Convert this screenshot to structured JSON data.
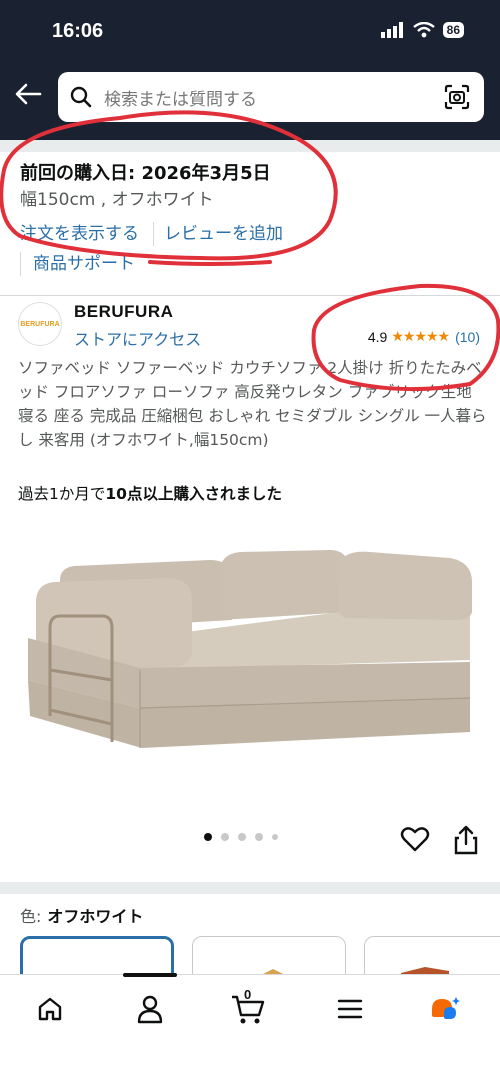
{
  "status_bar": {
    "time": "16:06",
    "battery": "86"
  },
  "search": {
    "placeholder": "検索または質問する"
  },
  "purchase": {
    "title": "前回の購入日: 2026年3月5日",
    "variant": "幅150cm , オフホワイト",
    "view_order": "注文を表示する",
    "add_review": "レビューを追加",
    "support": "商品サポート"
  },
  "seller": {
    "logo_text": "BERUFURA",
    "name": "BERUFURA",
    "store_link": "ストアにアクセス",
    "rating": "4.9",
    "stars": "★★★★★",
    "rating_count": "(10)"
  },
  "product": {
    "description": "ソファベッド ソファーベッド カウチソファ 2人掛け 折りたたみベッド フロアソファ ローソファ 高反発ウレタン ファブリック生地 寝る 座る 完成品 圧縮梱包 おしゃれ セミダブル シングル 一人暮らし 来客用 (オフホワイト,幅150cm)",
    "bought_prefix": "過去1か月で",
    "bought_bold": "10点以上購入されました",
    "image_count": 5,
    "active_image": 1
  },
  "color": {
    "label": "色:",
    "value": "オフホワイト"
  },
  "bottom_nav": {
    "cart_count": "0"
  },
  "colors": {
    "header_bg": "#1a2130",
    "link": "#2a6fa8",
    "star": "#f08804",
    "annotation": "#e0303a"
  }
}
